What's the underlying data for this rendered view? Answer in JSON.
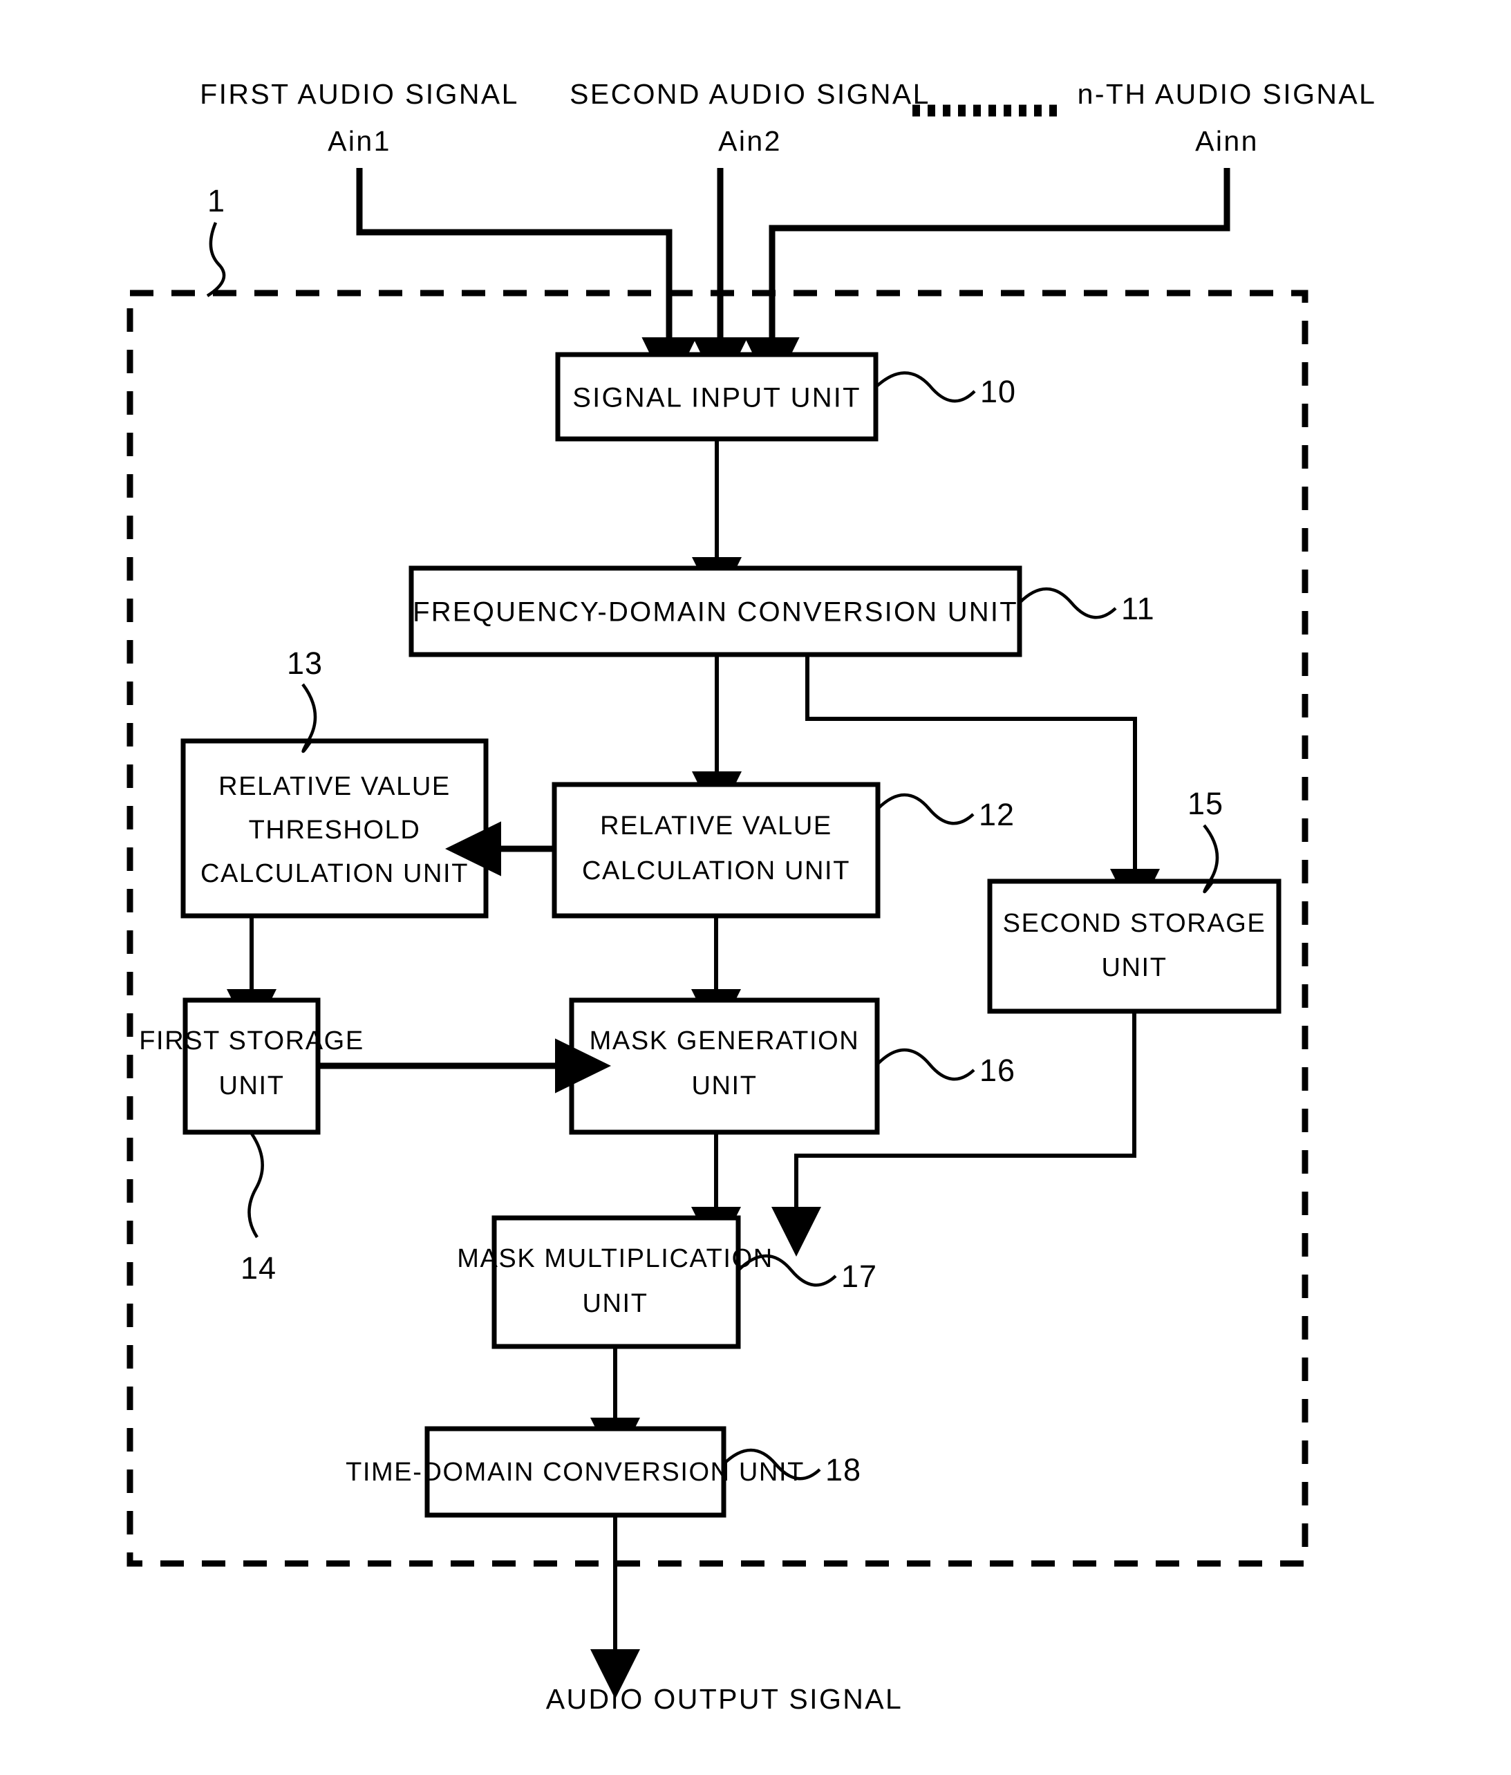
{
  "figure": {
    "system_ref": "1",
    "inputs": [
      {
        "name": "first-audio-signal",
        "label": "FIRST AUDIO SIGNAL",
        "signal": "Ain1"
      },
      {
        "name": "second-audio-signal",
        "label": "SECOND AUDIO SIGNAL",
        "signal": "Ain2"
      },
      {
        "name": "nth-audio-signal",
        "label": "n-TH AUDIO SIGNAL",
        "signal": "Ainn"
      }
    ],
    "ellipsis": "..........",
    "output": {
      "label": "AUDIO OUTPUT SIGNAL"
    },
    "blocks": [
      {
        "id": "signal-input-unit",
        "ref": "10",
        "lines": [
          "SIGNAL INPUT UNIT"
        ]
      },
      {
        "id": "frequency-domain-conversion-unit",
        "ref": "11",
        "lines": [
          "FREQUENCY-DOMAIN CONVERSION UNIT"
        ]
      },
      {
        "id": "relative-value-calculation-unit",
        "ref": "12",
        "lines": [
          "RELATIVE VALUE",
          "CALCULATION UNIT"
        ]
      },
      {
        "id": "relative-value-threshold-calculation-unit",
        "ref": "13",
        "lines": [
          "RELATIVE VALUE",
          "THRESHOLD",
          "CALCULATION UNIT"
        ]
      },
      {
        "id": "first-storage-unit",
        "ref": "14",
        "lines": [
          "FIRST STORAGE",
          "UNIT"
        ]
      },
      {
        "id": "second-storage-unit",
        "ref": "15",
        "lines": [
          "SECOND STORAGE",
          "UNIT"
        ]
      },
      {
        "id": "mask-generation-unit",
        "ref": "16",
        "lines": [
          "MASK GENERATION",
          "UNIT"
        ]
      },
      {
        "id": "mask-multiplication-unit",
        "ref": "17",
        "lines": [
          "MASK MULTIPLICATION",
          "UNIT"
        ]
      },
      {
        "id": "time-domain-conversion-unit",
        "ref": "18",
        "lines": [
          "TIME-DOMAIN CONVERSION UNIT"
        ]
      }
    ],
    "colors": {
      "ink": "#000000",
      "paper": "#ffffff"
    }
  }
}
